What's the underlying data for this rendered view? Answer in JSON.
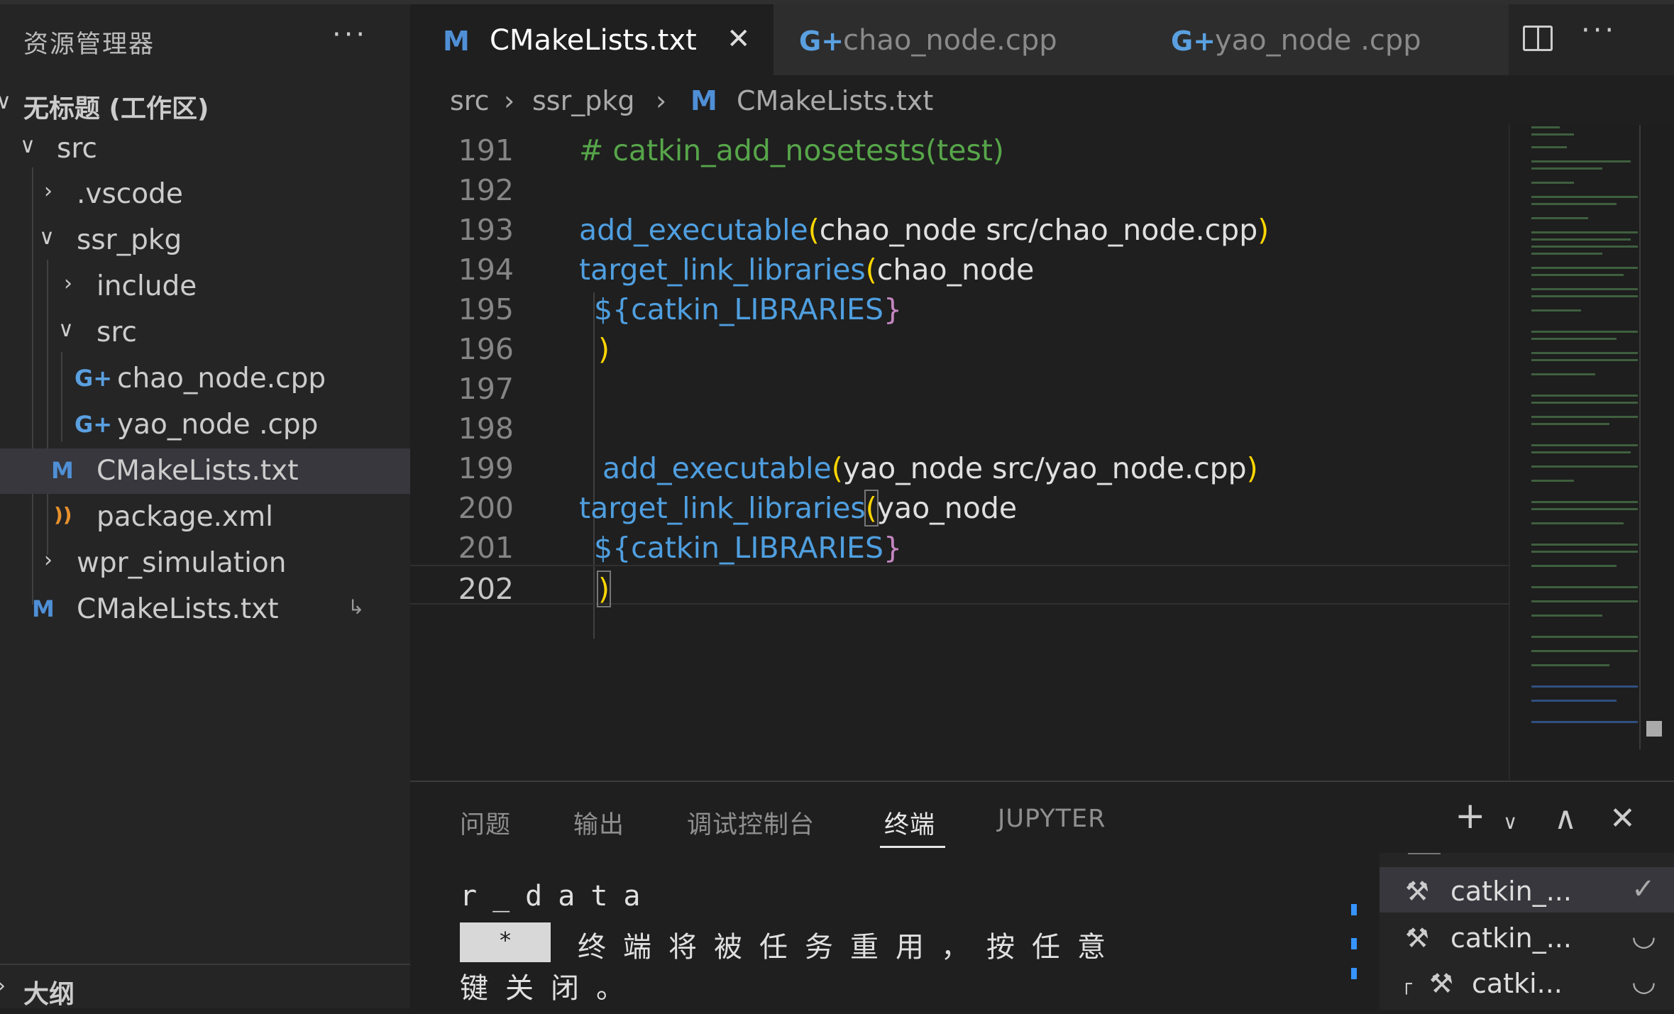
{
  "sidebar": {
    "title": "资源管理器",
    "more": "···",
    "workspace": "无标题 (工作区)",
    "tree": [
      {
        "label": "src",
        "chev": "∨"
      },
      {
        "label": ".vscode",
        "chev": "›"
      },
      {
        "label": "ssr_pkg",
        "chev": "∨"
      },
      {
        "label": "include",
        "chev": "›"
      },
      {
        "label": "src",
        "chev": "∨"
      },
      {
        "label": "chao_node.cpp",
        "icon": "G+"
      },
      {
        "label": "yao_node .cpp",
        "icon": "G+"
      },
      {
        "label": "CMakeLists.txt",
        "icon": "M"
      },
      {
        "label": "package.xml",
        "icon": "))"
      },
      {
        "label": "wpr_simulation",
        "chev": "›"
      },
      {
        "label": "CMakeLists.txt",
        "icon": "M",
        "extra": "↳"
      }
    ],
    "outline": "大纲"
  },
  "tabs": [
    {
      "label": "CMakeLists.txt",
      "icon": "M",
      "close": "✕"
    },
    {
      "label": "chao_node.cpp",
      "icon": "G+"
    },
    {
      "label": "yao_node .cpp",
      "icon": "G+"
    }
  ],
  "tab_actions": {
    "more": "···"
  },
  "breadcrumb": [
    "src",
    "›",
    "ssr_pkg",
    "›",
    "M",
    "CMakeLists.txt"
  ],
  "editor": {
    "line_numbers": [
      "191",
      "192",
      "193",
      "194",
      "195",
      "196",
      "197",
      "198",
      "199",
      "200",
      "201",
      "202"
    ],
    "l191": "# catkin_add_nosetests(test)",
    "l193_fn": "add_executable",
    "l193_open": "(",
    "l193_args": "chao_node src/chao_node.cpp",
    "l193_close": ")",
    "l194_fn": "target_link_libraries",
    "l194_open": "(",
    "l194_args": "chao_node",
    "l195_dollar": "${",
    "l195_var": "catkin_LIBRARIES",
    "l195_close": "}",
    "l196": ")",
    "l199_fn": "add_executable",
    "l199_open": "(",
    "l199_args": "yao_node src/yao_node.cpp",
    "l199_close": ")",
    "l200_fn": "target_link_libraries",
    "l200_open": "(",
    "l200_args": "yao_node",
    "l201_dollar": "${",
    "l201_var": "catkin_LIBRARIES",
    "l201_close": "}",
    "l202": ")"
  },
  "panel": {
    "tabs": [
      "问题",
      "输出",
      "调试控制台",
      "终端",
      "JUPYTER"
    ],
    "add": "+",
    "dropdown": "∨",
    "maximize": "∧",
    "close": "✕",
    "term_line1": "r_data",
    "term_star": "*",
    "term_line2": "终端将被任务重用，按任意",
    "term_line3": "键关闭。",
    "tasks": [
      {
        "label": "catkin_...",
        "status": "✓"
      },
      {
        "label": "catkin_...",
        "status": "◡"
      },
      {
        "label": "catki...",
        "status": "◡"
      }
    ]
  },
  "colors": {
    "keyword_blue": "#4f9fe0",
    "comment_green": "#57a64a",
    "bracket_yellow": "#ffd700",
    "brace_purple": "#c586c0",
    "cmake_icon": "#4f8fd6",
    "cpp_icon": "#5aa0e0",
    "rss_icon": "#e8912d"
  }
}
